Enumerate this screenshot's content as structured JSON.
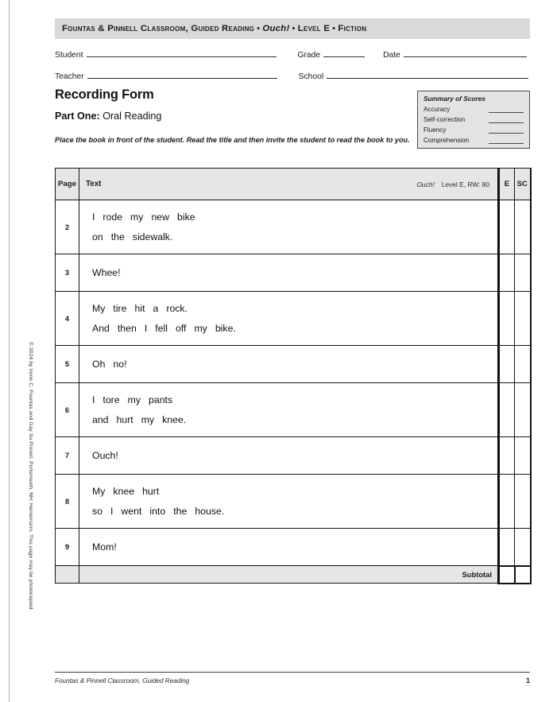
{
  "page_edge": {
    "present": true
  },
  "copyright_vertical": "© 2024 by Irene C. Fountas and Gay Su Pinnell. Portsmouth, NH: Heinemann. This page may be photocopied.",
  "title_band": {
    "series": "Fountas & Pinnell Classroom, Guided Reading",
    "separator": "•",
    "book_title": "Ouch!",
    "level": "Level E",
    "genre": "Fiction"
  },
  "fields": {
    "student_label": "Student",
    "grade_label": "Grade",
    "date_label": "Date",
    "teacher_label": "Teacher",
    "school_label": "School",
    "student_value": "",
    "grade_value": "",
    "date_value": "",
    "teacher_value": "",
    "school_value": ""
  },
  "headings": {
    "form_title": "Recording Form",
    "part_label": "Part One:",
    "part_value": "Oral Reading",
    "instruction": "Place the book in front of the student. Read the title and then invite the student to read the book to you."
  },
  "summary_of_scores": {
    "title": "Summary of Scores",
    "rows": [
      {
        "label": "Accuracy",
        "value": ""
      },
      {
        "label": "Self-correction",
        "value": ""
      },
      {
        "label": "Fluency",
        "value": ""
      },
      {
        "label": "Comprehension",
        "value": ""
      }
    ]
  },
  "table": {
    "headers": {
      "page": "Page",
      "text": "Text",
      "book_title": "Ouch!",
      "book_info": "Level E, RW: 80",
      "e": "E",
      "sc": "SC"
    },
    "rows": [
      {
        "page": "2",
        "lines": [
          "I rode my new bike",
          "on the sidewalk."
        ],
        "e": "",
        "sc": ""
      },
      {
        "page": "3",
        "lines": [
          "Whee!"
        ],
        "e": "",
        "sc": ""
      },
      {
        "page": "4",
        "lines": [
          "My tire hit a rock.",
          "And then I fell off my bike."
        ],
        "e": "",
        "sc": ""
      },
      {
        "page": "5",
        "lines": [
          "Oh no!"
        ],
        "e": "",
        "sc": ""
      },
      {
        "page": "6",
        "lines": [
          "I tore my pants",
          "and hurt my knee."
        ],
        "e": "",
        "sc": ""
      },
      {
        "page": "7",
        "lines": [
          "Ouch!"
        ],
        "e": "",
        "sc": ""
      },
      {
        "page": "8",
        "lines": [
          "My knee hurt",
          "so I went into the house."
        ],
        "e": "",
        "sc": ""
      },
      {
        "page": "9",
        "lines": [
          "Mom!"
        ],
        "e": "",
        "sc": ""
      }
    ],
    "subtotal_label": "Subtotal",
    "subtotal_e": "",
    "subtotal_sc": ""
  },
  "footer": {
    "text": "Fountas & Pinnell Classroom, Guided Reading",
    "page_number": "1"
  },
  "colors": {
    "band_gray": "#d9d9d9",
    "table_header_gray": "#e6e6e6",
    "summary_gray": "#e3e3e3",
    "rule": "#141414"
  }
}
